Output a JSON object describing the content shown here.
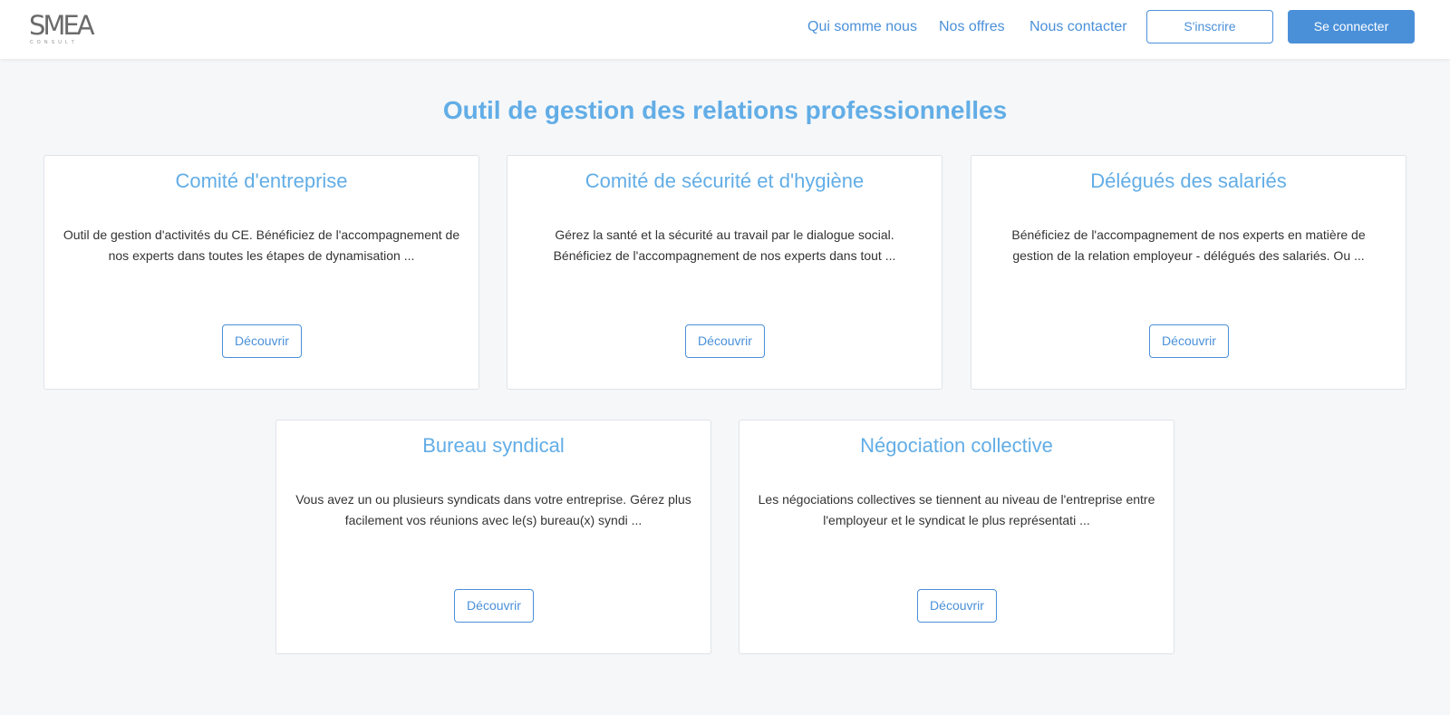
{
  "header": {
    "logo_text": "SMEA",
    "logo_subtext": "CONSULT",
    "nav": [
      {
        "label": "Qui somme nous"
      },
      {
        "label": "Nos offres"
      },
      {
        "label": "Nous contacter"
      }
    ],
    "signup_label": "S'inscrire",
    "login_label": "Se connecter"
  },
  "main": {
    "title": "Outil de gestion des relations professionnelles",
    "cards": [
      {
        "title": "Comité d'entreprise",
        "description": "Outil de gestion d'activités du CE. Bénéficiez de l'accompagnement de nos experts dans toutes les étapes de dynamisation ...",
        "button": "Découvrir"
      },
      {
        "title": "Comité de sécurité et d'hygiène",
        "description": "Gérez la santé et la sécurité au travail par le dialogue social. Bénéficiez de l'accompagnement de nos experts dans tout ...",
        "button": "Découvrir"
      },
      {
        "title": "Délégués des salariés",
        "description": "Bénéficiez de l'accompagnement de nos experts en matière de gestion de la relation employeur - délégués des salariés. Ou ...",
        "button": "Découvrir"
      },
      {
        "title": "Bureau syndical",
        "description": "Vous avez un ou plusieurs syndicats dans votre entreprise. Gérez plus facilement vos réunions avec le(s) bureau(x) syndi ...",
        "button": "Découvrir"
      },
      {
        "title": "Négociation collective",
        "description": "Les négociations collectives se tiennent au niveau de l'entreprise entre l'employeur et le syndicat le plus représentati ...",
        "button": "Découvrir"
      }
    ]
  },
  "colors": {
    "accent": "#4a90d9",
    "title": "#62ade6",
    "background": "#f5f7f9"
  }
}
